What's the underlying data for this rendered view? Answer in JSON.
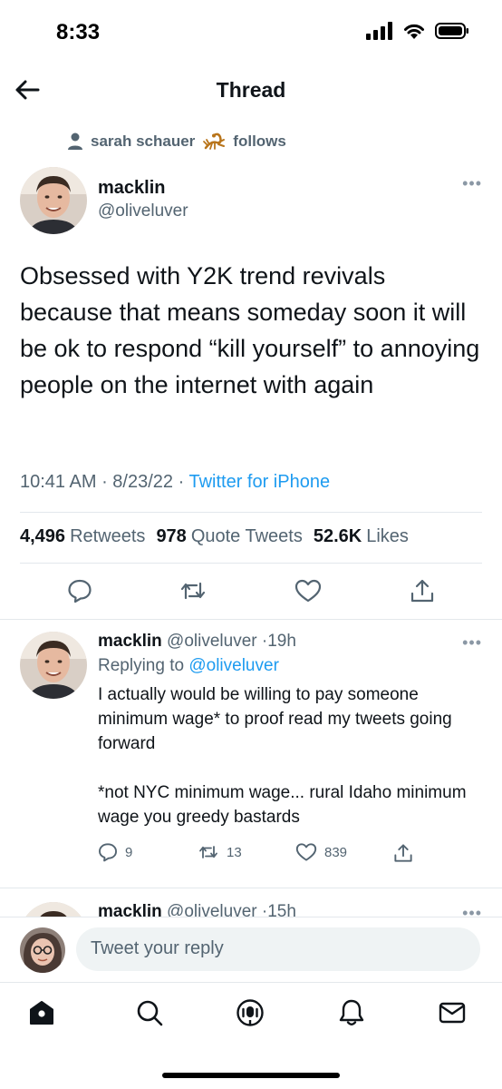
{
  "status": {
    "time": "8:33"
  },
  "header": {
    "title": "Thread"
  },
  "social_context": {
    "text": "sarah schauer",
    "suffix": "follows"
  },
  "main_tweet": {
    "name": "macklin",
    "handle": "@oliveluver",
    "text": "Obsessed with Y2K trend revivals because that means someday soon it will be ok to respond “kill yourself” to annoying people on the internet with again",
    "time": "10:41 AM",
    "date": "8/23/22",
    "source": "Twitter for iPhone",
    "stats": {
      "retweets_count": "4,496",
      "retweets_label": "Retweets",
      "quotes_count": "978",
      "quotes_label": "Quote Tweets",
      "likes_count": "52.6K",
      "likes_label": "Likes"
    }
  },
  "replies": [
    {
      "name": "macklin",
      "handle": "@oliveluver",
      "time": "19h",
      "replying_to_label": "Replying to",
      "replying_to": "@oliveluver",
      "text_1": "I actually would be willing to pay someone minimum wage* to proof read my tweets going forward",
      "text_2": "*not NYC minimum wage... rural Idaho minimum wage you greedy bastards",
      "reply_count": "9",
      "retweet_count": "13",
      "like_count": "839"
    },
    {
      "name": "macklin",
      "handle": "@oliveluver",
      "time": "15h"
    }
  ],
  "compose": {
    "placeholder": "Tweet your reply"
  },
  "tabs": [
    "home-icon",
    "search-icon",
    "spaces-icon",
    "notifications-icon",
    "messages-icon"
  ],
  "colors": {
    "accent": "#1d9bf0",
    "secondary_text": "#536471",
    "divider": "#e3e8ec"
  }
}
